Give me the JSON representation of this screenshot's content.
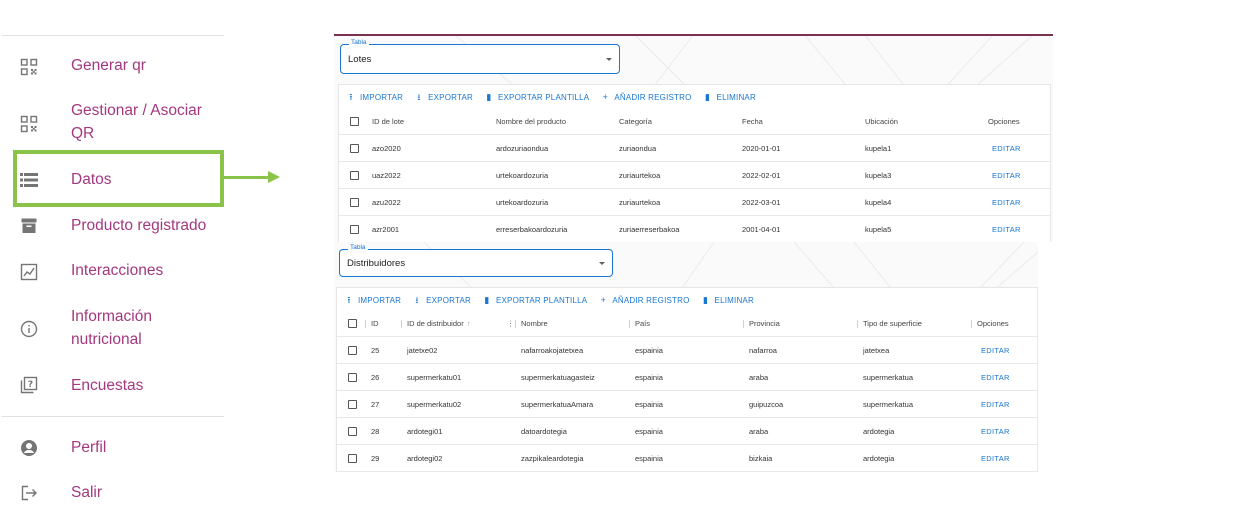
{
  "sidebar": {
    "items": [
      {
        "label": "Generar qr",
        "icon": "qr-code-icon"
      },
      {
        "label": "Gestionar / Asociar\nQR",
        "icon": "qr-code-icon"
      },
      {
        "label": "Datos",
        "icon": "list-icon"
      },
      {
        "label": "Producto registrado",
        "icon": "archive-icon"
      },
      {
        "label": "Interacciones",
        "icon": "chart-icon"
      },
      {
        "label": "Información\nnutricional",
        "icon": "info-icon"
      },
      {
        "label": "Encuestas",
        "icon": "quiz-icon"
      },
      {
        "label": "Perfil",
        "icon": "account-icon"
      },
      {
        "label": "Salir",
        "icon": "logout-icon"
      }
    ],
    "accent_color": "#a3387f",
    "highlight_color": "#8bc34a"
  },
  "lotes": {
    "select_label": "Tabla",
    "select_value": "Lotes",
    "toolbar": {
      "import": "IMPORTAR",
      "export": "EXPORTAR",
      "export_template": "EXPORTAR PLANTILLA",
      "add": "AÑADIR REGISTRO",
      "delete": "ELIMINAR"
    },
    "columns": [
      "ID de lote",
      "Nombre del producto",
      "Categoría",
      "Fecha",
      "Ubicación",
      "Opciones"
    ],
    "rows": [
      [
        "azo2020",
        "ardozuriaondua",
        "zuriaondua",
        "2020-01-01",
        "kupela1",
        "EDITAR"
      ],
      [
        "uaz2022",
        "urtekoardozuria",
        "zuriaurtekoa",
        "2022-02-01",
        "kupela3",
        "EDITAR"
      ],
      [
        "azu2022",
        "urtekoardozuria",
        "zuriaurtekoa",
        "2022-03-01",
        "kupela4",
        "EDITAR"
      ],
      [
        "azr2001",
        "erreserbakoardozuria",
        "zuriaerreserbakoa",
        "2001-04-01",
        "kupela5",
        "EDITAR"
      ]
    ]
  },
  "distribuidores": {
    "select_label": "Tabla",
    "select_value": "Distribuidores",
    "toolbar": {
      "import": "IMPORTAR",
      "export": "EXPORTAR",
      "export_template": "EXPORTAR PLANTILLA",
      "add": "AÑADIR REGISTRO",
      "delete": "ELIMINAR"
    },
    "columns": [
      "ID",
      "ID de distribuidor",
      "Nombre",
      "País",
      "Provincia",
      "Tipo de superficie",
      "Opciones"
    ],
    "rows": [
      [
        "25",
        "jatetxe02",
        "nafarroakojatetxea",
        "espainia",
        "nafarroa",
        "jatetxea",
        "EDITAR"
      ],
      [
        "26",
        "supermerkatu01",
        "supermerkatuagasteiz",
        "espainia",
        "araba",
        "supermerkatua",
        "EDITAR"
      ],
      [
        "27",
        "supermerkatu02",
        "supermerkatuaAmara",
        "espainia",
        "guipuzcoa",
        "supermerkatua",
        "EDITAR"
      ],
      [
        "28",
        "ardotegi01",
        "datoardotegia",
        "espainia",
        "araba",
        "ardotegia",
        "EDITAR"
      ],
      [
        "29",
        "ardotegi02",
        "zazpikaleardotegia",
        "espainia",
        "bizkaia",
        "ardotegia",
        "EDITAR"
      ]
    ]
  }
}
